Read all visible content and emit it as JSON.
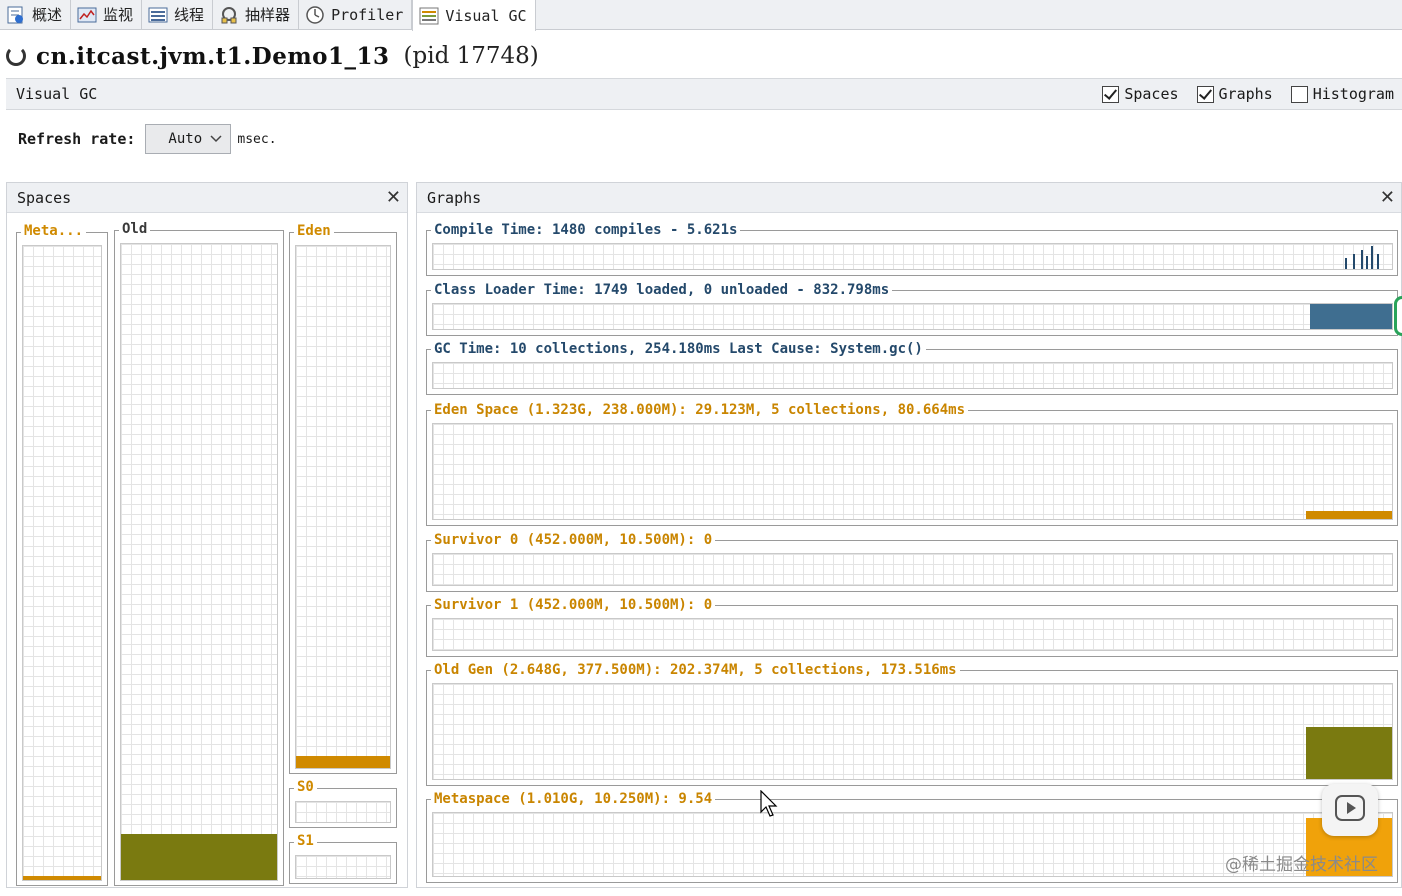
{
  "tabs": [
    {
      "label": "概述",
      "icon": "overview-icon",
      "active": false
    },
    {
      "label": "监视",
      "icon": "monitor-icon",
      "active": false
    },
    {
      "label": "线程",
      "icon": "threads-icon",
      "active": false
    },
    {
      "label": "抽样器",
      "icon": "sampler-icon",
      "active": false
    },
    {
      "label": "Profiler",
      "icon": "profiler-icon",
      "active": false
    },
    {
      "label": "Visual GC",
      "icon": "visualgc-icon",
      "active": true
    }
  ],
  "app": {
    "title": "cn.itcast.jvm.t1.Demo1_13",
    "pid": "(pid 17748)"
  },
  "plugin": {
    "title": "Visual GC",
    "checkboxes": [
      {
        "label": "Spaces",
        "checked": true
      },
      {
        "label": "Graphs",
        "checked": true
      },
      {
        "label": "Histogram",
        "checked": false
      }
    ]
  },
  "refresh": {
    "label": "Refresh rate:",
    "value": "Auto",
    "unit": "msec."
  },
  "spaces": {
    "title": "Spaces",
    "meta": {
      "label": "Meta...",
      "usage": 0.01
    },
    "old": {
      "label": "Old",
      "usage": 0.075
    },
    "eden": {
      "label": "Eden",
      "usage": 0.02
    },
    "s0": {
      "label": "S0",
      "usage": 0
    },
    "s1": {
      "label": "S1",
      "usage": 0
    }
  },
  "graphs": {
    "title": "Graphs",
    "compile": "Compile Time: 1480 compiles - 5.621s",
    "classloader": "Class Loader Time: 1749 loaded, 0 unloaded - 832.798ms",
    "gc": "GC Time: 10 collections, 254.180ms Last Cause: System.gc()",
    "eden": "Eden Space (1.323G, 238.000M): 29.123M, 5 collections, 80.664ms",
    "s0": "Survivor 0 (452.000M, 10.500M): 0",
    "s1": "Survivor 1 (452.000M, 10.500M): 0",
    "old": "Old Gen (2.648G, 377.500M): 202.374M, 5 collections, 173.516ms",
    "meta": "Metaspace (1.010G, 10.250M): 9.54"
  },
  "colors": {
    "accent_orange": "#d08a00",
    "old_fill": "#7a7a10",
    "graph_blue": "#3f6e90",
    "label_blue": "#24496b"
  },
  "watermark": "@稀土掘金技术社区"
}
